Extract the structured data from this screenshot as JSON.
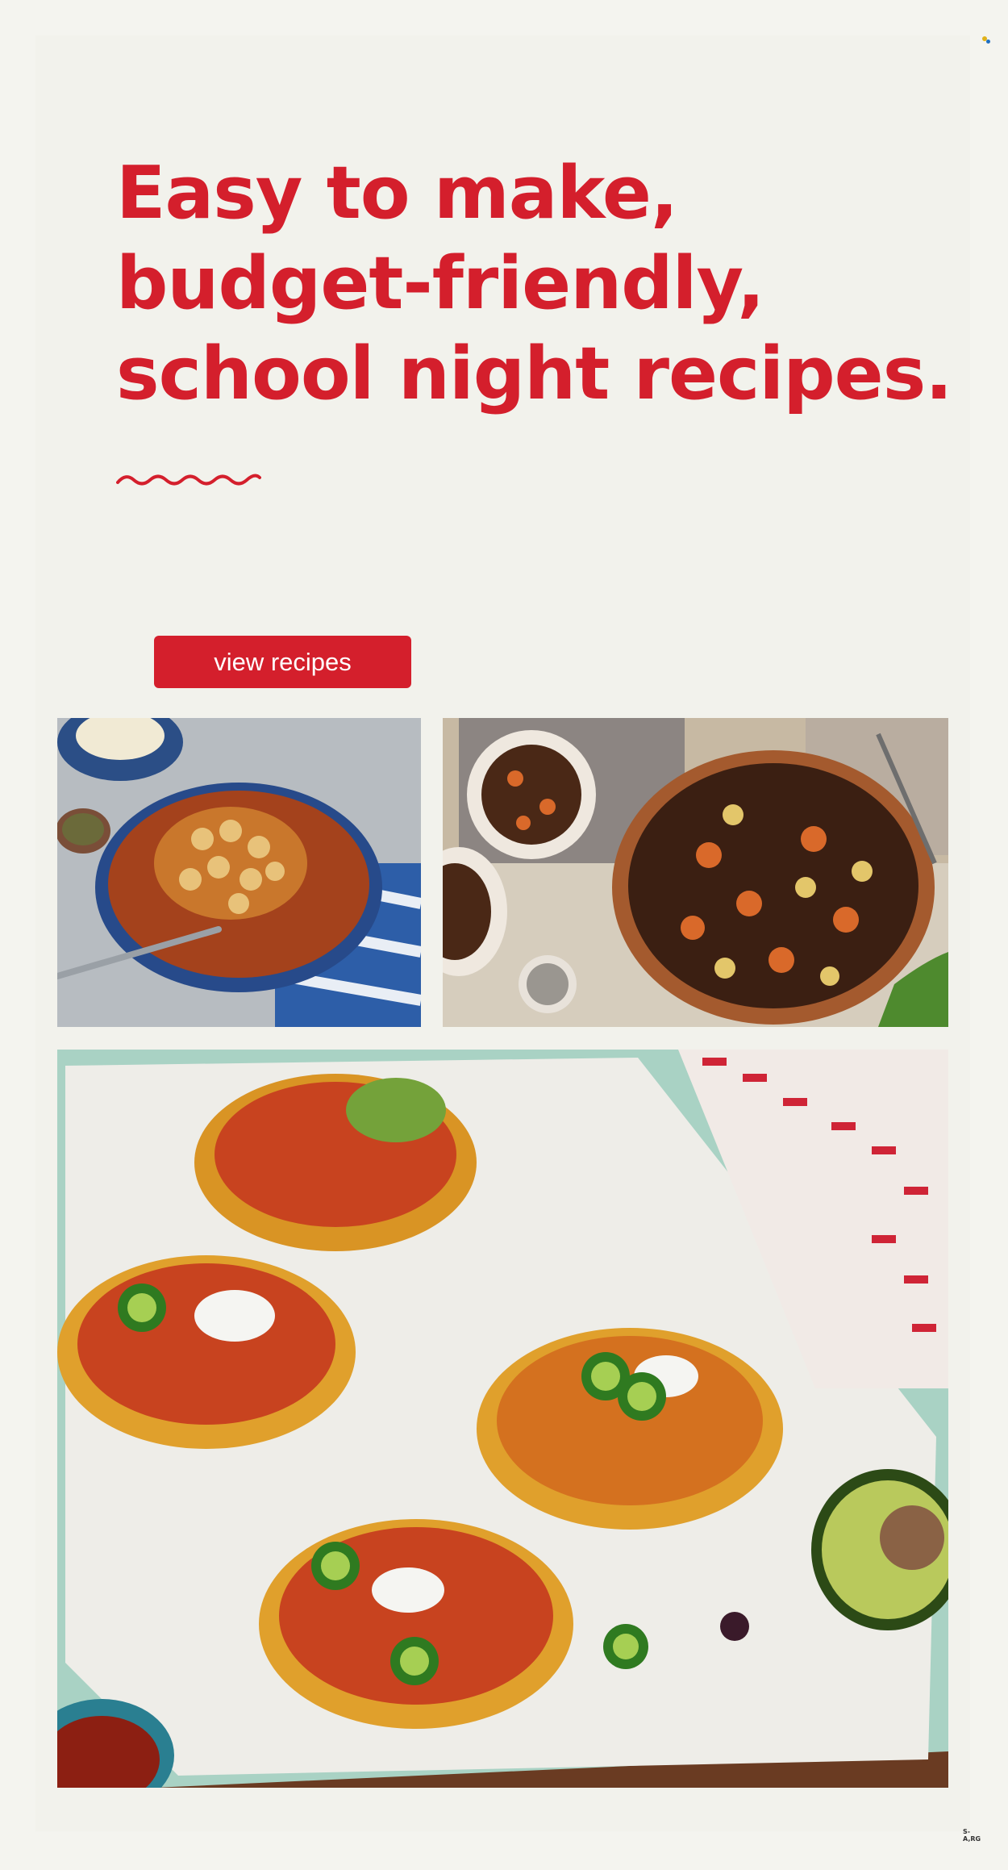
{
  "headline": {
    "line1": "Easy to make,",
    "line2": "budget-friendly,",
    "line3": "school night recipes."
  },
  "cta": {
    "label": "view recipes"
  },
  "photos": {
    "soup": "pasta-soup-photo",
    "stew": "beef-stew-photo",
    "tostadas": "tostadas-photo"
  },
  "footer": {
    "code": "S-A,RG"
  },
  "colors": {
    "brand_red": "#d41f2c",
    "background": "#f2f2ec"
  }
}
